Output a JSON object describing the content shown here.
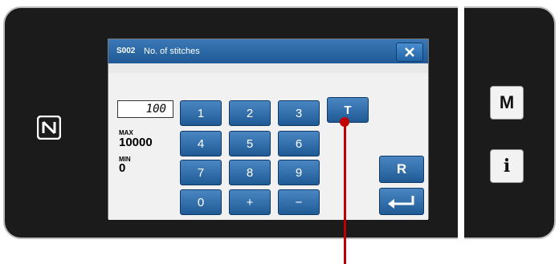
{
  "dialog": {
    "code": "S002",
    "title": "No. of stitches"
  },
  "input": {
    "value": "100",
    "max_label": "MAX",
    "max_value": "10000",
    "min_label": "MIN",
    "min_value": "0"
  },
  "keypad": {
    "k1": "1",
    "k2": "2",
    "k3": "3",
    "kT": "T",
    "k4": "4",
    "k5": "5",
    "k6": "6",
    "k7": "7",
    "k8": "8",
    "k9": "9",
    "k0": "0",
    "kplus": "+",
    "kminus": "−",
    "reset": "R"
  },
  "side": {
    "menu": "M",
    "info": "i"
  },
  "icons": {
    "close": "close-icon",
    "enter": "enter-icon",
    "nfc": "nfc-icon"
  },
  "colors": {
    "button_blue": "#1f5a95",
    "callout_red": "#c00000"
  }
}
